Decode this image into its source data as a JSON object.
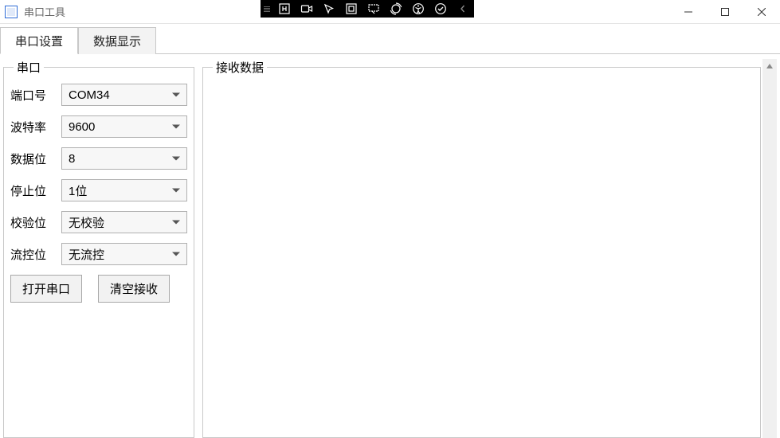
{
  "window": {
    "title": "串口工具"
  },
  "tabs": [
    {
      "label": "串口设置",
      "active": true
    },
    {
      "label": "数据显示",
      "active": false
    }
  ],
  "serial_group": {
    "legend": "串口",
    "fields": {
      "port": {
        "label": "端口号",
        "value": "COM34"
      },
      "baud": {
        "label": "波特率",
        "value": "9600"
      },
      "databits": {
        "label": "数据位",
        "value": "8"
      },
      "stopbits": {
        "label": "停止位",
        "value": "1位"
      },
      "parity": {
        "label": "校验位",
        "value": "无校验"
      },
      "flow": {
        "label": "流控位",
        "value": "无流控"
      }
    },
    "buttons": {
      "open": "打开串口",
      "clear": "清空接收"
    }
  },
  "recv_group": {
    "legend": "接收数据"
  }
}
